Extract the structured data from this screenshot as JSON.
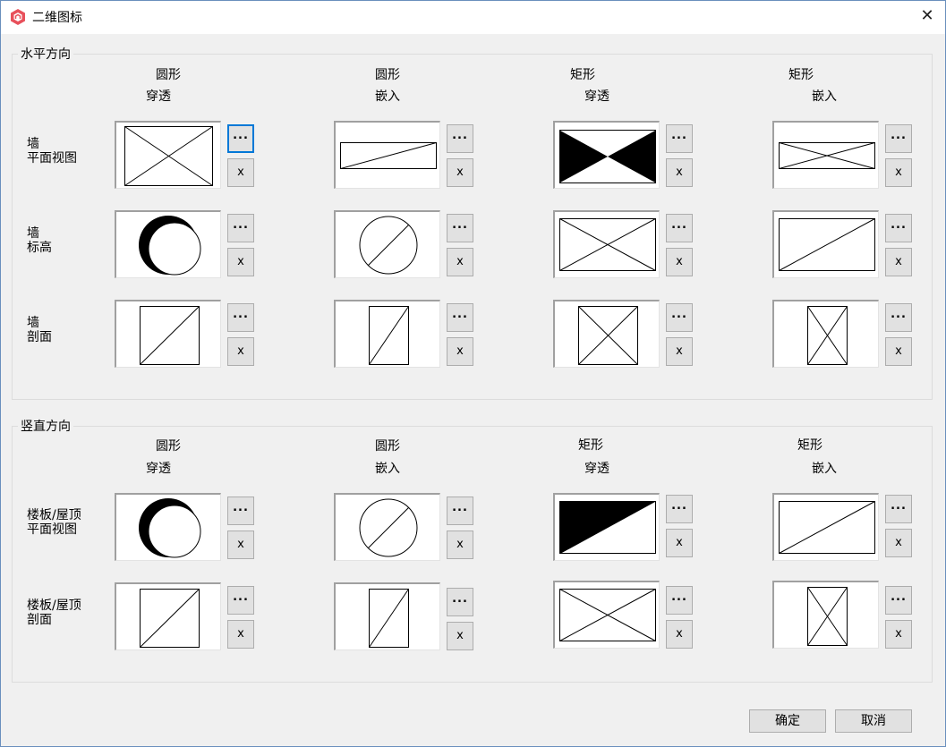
{
  "window": {
    "title": "二维图标",
    "close_glyph": "✕"
  },
  "horizontal": {
    "legend": "水平方向",
    "columns": [
      {
        "shape": "圆形",
        "mode": "穿透"
      },
      {
        "shape": "圆形",
        "mode": "嵌入"
      },
      {
        "shape": "矩形",
        "mode": "穿透"
      },
      {
        "shape": "矩形",
        "mode": "嵌入"
      }
    ],
    "rows": [
      {
        "label_line1": "墙",
        "label_line2": "平面视图"
      },
      {
        "label_line1": "墙",
        "label_line2": "标高"
      },
      {
        "label_line1": "墙",
        "label_line2": "剖面"
      }
    ]
  },
  "vertical": {
    "legend": "竖直方向",
    "columns": [
      {
        "shape": "圆形",
        "mode": "穿透"
      },
      {
        "shape": "圆形",
        "mode": "嵌入"
      },
      {
        "shape": "矩形",
        "mode": "穿透"
      },
      {
        "shape": "矩形",
        "mode": "嵌入"
      }
    ],
    "rows": [
      {
        "label_line1": "楼板/屋顶",
        "label_line2": "平面视图"
      },
      {
        "label_line1": "楼板/屋顶",
        "label_line2": "剖面"
      }
    ]
  },
  "buttons": {
    "browse_label": "...",
    "clear_label": "x"
  },
  "footer": {
    "ok_label": "确定",
    "cancel_label": "取消"
  },
  "icons": {
    "app": "revit-logo-icon",
    "close": "close-icon"
  },
  "colors": {
    "focus_border": "#0078d7",
    "app_icon": "#e8505b"
  }
}
